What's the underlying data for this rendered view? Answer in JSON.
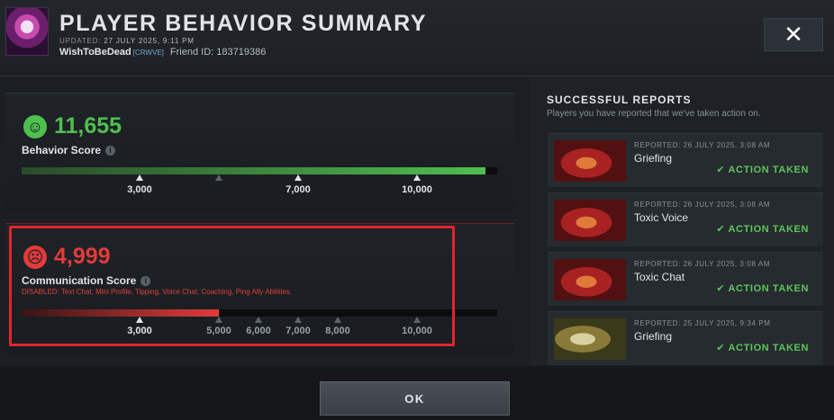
{
  "header": {
    "title": "PLAYER BEHAVIOR SUMMARY",
    "updated_label": "UPDATED:",
    "updated_value": "27 JULY 2025, 9:11 PM",
    "player_name": "WishToBeDead",
    "guild_tag": "[CRWVE]",
    "friend_id": "Friend ID: 183719386",
    "close_icon": "close-icon"
  },
  "behavior": {
    "score": "11,655",
    "label": "Behavior Score",
    "fill_fraction": 0.975,
    "color": "#4fbf4f",
    "ticks": [
      "3,000",
      "7,000",
      "10,000"
    ]
  },
  "communication": {
    "score": "4,999",
    "label": "Communication Score",
    "disabled": "DISABLED:  Text Chat, Mini Profile, Tipping, Voice Chat, Coaching, Ping Ally Abilities.",
    "fill_fraction": 0.415,
    "color": "#e23b3b",
    "ticks": [
      "3,000",
      "5,000",
      "6,000",
      "7,000",
      "8,000",
      "10,000"
    ]
  },
  "reports": {
    "title": "SUCCESSFUL REPORTS",
    "subtitle": "Players you have reported that we've taken action on.",
    "items": [
      {
        "date": "REPORTED: 26 JULY 2025, 3:08 AM",
        "reason": "Griefing",
        "action": "ACTION TAKEN"
      },
      {
        "date": "REPORTED: 26 JULY 2025, 3:08 AM",
        "reason": "Toxic Voice",
        "action": "ACTION TAKEN"
      },
      {
        "date": "REPORTED: 26 JULY 2025, 3:08 AM",
        "reason": "Toxic Chat",
        "action": "ACTION TAKEN"
      },
      {
        "date": "REPORTED: 25 JULY 2025, 9:34 PM",
        "reason": "Griefing",
        "action": "ACTION TAKEN"
      }
    ]
  },
  "footer": {
    "ok_label": "OK"
  }
}
